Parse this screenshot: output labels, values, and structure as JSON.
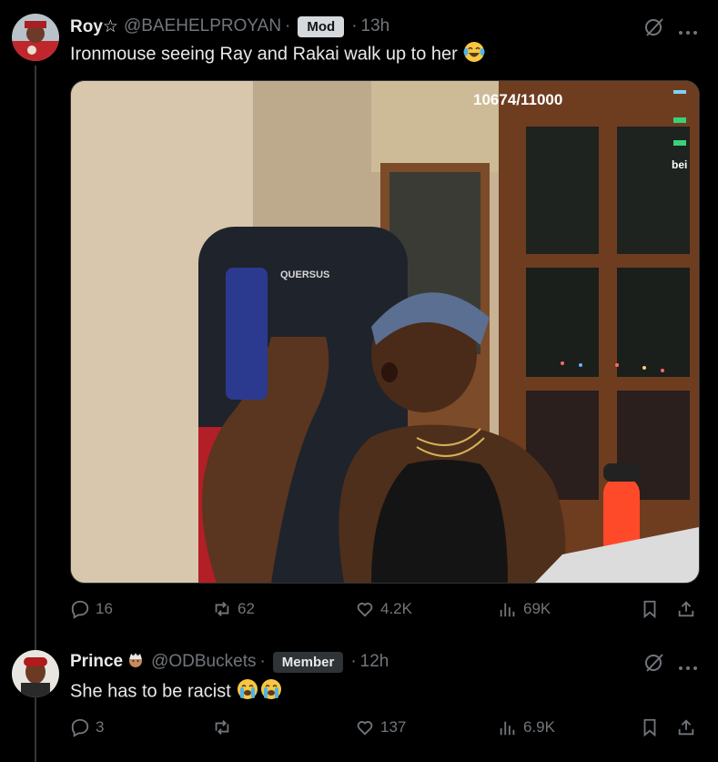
{
  "posts": [
    {
      "name": "Roy☆",
      "handle": "@BAEHELPROYAN",
      "badge": "Mod",
      "time": "13h",
      "text": "Ironmouse seeing Ray and Rakai walk up to her",
      "media": {
        "overlay_counter": "10674/11000",
        "chair_brand": "QUERSUS",
        "overlay_side_text": "bei"
      },
      "stats": {
        "replies": "16",
        "reposts": "62",
        "likes": "4.2K",
        "views": "69K"
      }
    },
    {
      "name": "Prince",
      "handle": "@ODBuckets",
      "badge": "Member",
      "time": "12h",
      "text": "She has to be racist",
      "stats": {
        "replies": "3",
        "reposts": "",
        "likes": "137",
        "views": "6.9K"
      }
    }
  ],
  "separator": "·",
  "icons": [
    "grok-icon",
    "more-icon",
    "reply-icon",
    "repost-icon",
    "like-icon",
    "views-icon",
    "bookmark-icon",
    "share-icon",
    "laughing-emoji",
    "crying-emoji",
    "person-emoji"
  ],
  "colors": {
    "background": "#000000",
    "text": "#e7e9ea",
    "muted": "#71767b",
    "mod_badge": "#d6d9db",
    "member_badge": "#2f3336"
  }
}
